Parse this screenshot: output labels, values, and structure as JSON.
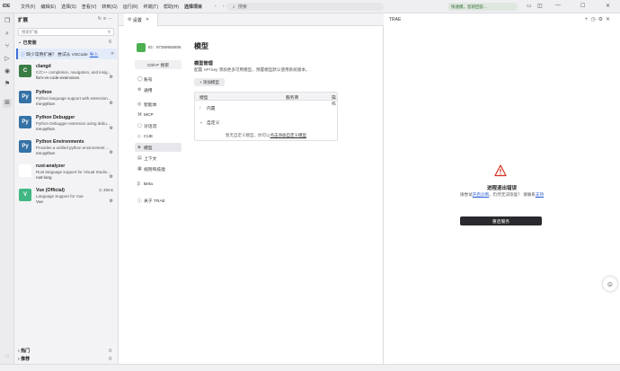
{
  "titlebar": {
    "logo": "IDE",
    "menus": [
      "文件(F)",
      "编辑(E)",
      "选择(S)",
      "查看(V)",
      "转到(G)",
      "运行(R)",
      "终端(T)",
      "帮助(H)"
    ],
    "active_menu": "选择项目",
    "search_placeholder": "搜索",
    "status_pill": "快速模，您新回答..."
  },
  "sidebar": {
    "title": "扩展",
    "search_placeholder": "搜索扩展",
    "installed_label": "已安装",
    "installed_count": "6",
    "banner": {
      "text": "缺少常用扩展？ 尝试从 VSCode",
      "link": "导入"
    },
    "extensions": [
      {
        "name": "clangd",
        "desc": "C/C++ completion, navigation, and insig...",
        "publisher": "llvm-vs-code-extensions",
        "icon": "clangd-icon",
        "color": "#3a7d44",
        "glyph": "C",
        "meta": ""
      },
      {
        "name": "Python",
        "desc": "Python language support with extension...",
        "publisher": "ms-python",
        "icon": "python-icon",
        "color": "#3572a5",
        "glyph": "Py",
        "meta": ""
      },
      {
        "name": "Python Debugger",
        "desc": "Python Debugger extension using debug...",
        "publisher": "ms-python",
        "icon": "python-debugger-icon",
        "color": "#3572a5",
        "glyph": "Py",
        "meta": ""
      },
      {
        "name": "Python Environments",
        "desc": "Provides a unified python environment ex...",
        "publisher": "ms-python",
        "icon": "python-env-icon",
        "color": "#3572a5",
        "glyph": "Py",
        "meta": ""
      },
      {
        "name": "rust-analyzer",
        "desc": "Rust language support for Visual Studio C...",
        "publisher": "rust-lang",
        "icon": "rust-icon",
        "color": "#ffffff",
        "glyph": "",
        "meta": ""
      },
      {
        "name": "Vue (Official)",
        "desc": "Language Support for Vue",
        "publisher": "Vue",
        "icon": "vue-icon",
        "color": "#41b883",
        "glyph": "V",
        "meta": "49ms"
      }
    ],
    "bottom_sections": [
      {
        "label": "热门",
        "count": "0"
      },
      {
        "label": "推荐",
        "count": "0"
      }
    ]
  },
  "editor": {
    "tab_label": "设置",
    "user_id": "ID：97359565806",
    "shortcut": "Ctrl+F 搜索",
    "nav": [
      {
        "label": "账号",
        "icon": "user-icon"
      },
      {
        "label": "通用",
        "icon": "gear-icon"
      },
      {
        "label": "智能体",
        "icon": "robot-icon"
      },
      {
        "label": "MCP",
        "icon": "mcp-icon"
      },
      {
        "label": "对话流",
        "icon": "chat-icon"
      },
      {
        "label": "CUE",
        "icon": "cue-icon"
      },
      {
        "label": "模型",
        "icon": "model-icon",
        "active": true
      },
      {
        "label": "上下文",
        "icon": "context-icon"
      },
      {
        "label": "规则和技能",
        "icon": "rules-icon"
      },
      {
        "label": "Beta",
        "icon": "beta-icon"
      },
      {
        "label": "关于 TRAE",
        "icon": "info-icon"
      }
    ],
    "content": {
      "title": "模型",
      "subtitle": "模型管理",
      "description": "配置 API key 添加更多可用模型，预置模型默认使用系统版本。",
      "add_button": "+ 添加模型",
      "columns": [
        "模型",
        "服务商",
        "操作"
      ],
      "rows": [
        "内置",
        "自定义"
      ],
      "empty_text": "暂无自定义模型，你可以",
      "empty_link": "点击添加自定义模型"
    }
  },
  "panel": {
    "title": "TRAE",
    "error_title": "进程退出错误",
    "error_desc_prefix": "请尝试",
    "error_link1": "开启诊断",
    "error_desc_mid": "。仍然无法恢复？ 请联系",
    "error_link2": "支持",
    "restart_button": "重启服务"
  },
  "colors": {
    "accent_blue": "#2f63d6",
    "warning_red": "#d93025",
    "restart_bg": "#2a2a2e"
  }
}
